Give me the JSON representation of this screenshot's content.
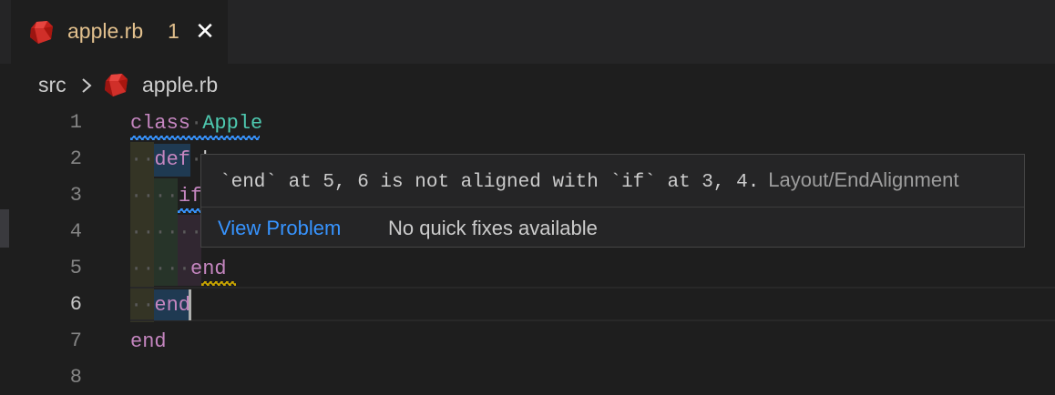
{
  "tab": {
    "file_name": "apple.rb",
    "problem_count": "1",
    "close_glyph": "✕",
    "icon": "ruby-icon"
  },
  "breadcrumb": {
    "folder": "src",
    "separator": "›",
    "file": "apple.rb"
  },
  "editor": {
    "line_numbers": [
      "1",
      "2",
      "3",
      "4",
      "5",
      "6",
      "7",
      "8"
    ],
    "active_line": "6",
    "lines": [
      [
        {
          "t": "class",
          "c": "kw"
        },
        {
          "t": "·",
          "c": "ws"
        },
        {
          "t": "Apple",
          "c": "cls"
        }
      ],
      [
        {
          "t": "··",
          "c": "ws"
        },
        {
          "t": "def",
          "c": "kw"
        },
        {
          "t": "·",
          "c": "ws"
        },
        {
          "t": "h",
          "c": ""
        }
      ],
      [
        {
          "t": "····",
          "c": "ws"
        },
        {
          "t": "if",
          "c": "kw"
        }
      ],
      [
        {
          "t": "······",
          "c": "ws"
        }
      ],
      [
        {
          "t": "····",
          "c": "ws"
        },
        {
          "t": "·",
          "c": "ws"
        },
        {
          "t": "end",
          "c": "kw"
        }
      ],
      [
        {
          "t": "··",
          "c": "ws"
        },
        {
          "t": "end",
          "c": "kw"
        }
      ],
      [
        {
          "t": "end",
          "c": "kw"
        }
      ],
      []
    ]
  },
  "hover": {
    "message": "`end` at 5, 6 is not aligned with `if` at 3, 4.",
    "source": "Layout/EndAlignment",
    "view_problem": "View Problem",
    "no_fixes": "No quick fixes available"
  },
  "colors": {
    "keyword": "#c586c0",
    "class_name": "#4ec9b0",
    "link": "#3794ff",
    "tab_text": "#e2c08d",
    "background": "#1e1e1e"
  }
}
